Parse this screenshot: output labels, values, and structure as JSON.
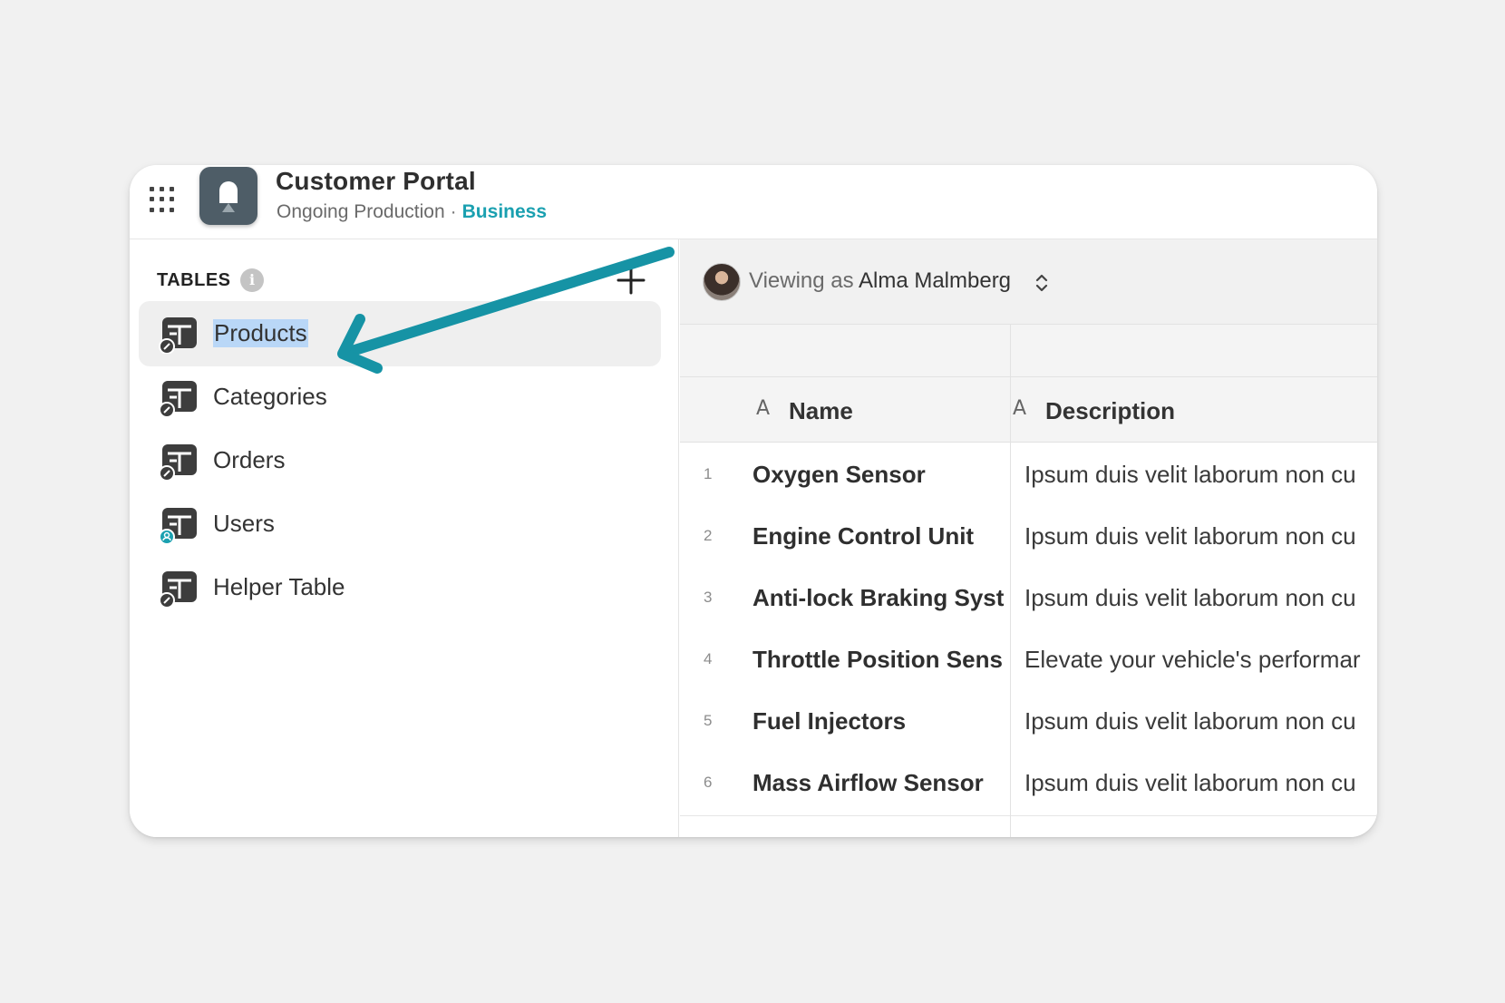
{
  "header": {
    "title": "Customer Portal",
    "subtitle": "Ongoing Production",
    "separator": "·",
    "plan": "Business",
    "menu_icon": "apps-grid-icon",
    "app_icon": "app-logo-icon"
  },
  "sidebar": {
    "section_label": "TABLES",
    "info_icon": "info-icon",
    "add_icon": "plus-icon",
    "items": [
      {
        "label": "Products",
        "icon": "table-icon",
        "selected": true
      },
      {
        "label": "Categories",
        "icon": "table-icon",
        "selected": false
      },
      {
        "label": "Orders",
        "icon": "table-icon",
        "selected": false
      },
      {
        "label": "Users",
        "icon": "users-table-icon",
        "selected": false
      },
      {
        "label": "Helper Table",
        "icon": "table-icon",
        "selected": false
      }
    ]
  },
  "viewbar": {
    "prefix": "Viewing as",
    "user": "Alma Malmberg",
    "switch_icon": "chevron-up-down-icon"
  },
  "table": {
    "columns": [
      {
        "type_icon": "A",
        "title": "Name"
      },
      {
        "type_icon": "A",
        "title": "Description"
      }
    ],
    "rows": [
      {
        "num": "1",
        "name": "Oxygen Sensor",
        "desc": "Ipsum duis velit laborum non cu"
      },
      {
        "num": "2",
        "name": "Engine Control Unit",
        "desc": "Ipsum duis velit laborum non cu"
      },
      {
        "num": "3",
        "name": "Anti-lock Braking Syst",
        "desc": "Ipsum duis velit laborum non cu"
      },
      {
        "num": "4",
        "name": "Throttle Position Sens",
        "desc": "Elevate your vehicle's performar"
      },
      {
        "num": "5",
        "name": "Fuel Injectors",
        "desc": "Ipsum duis velit laborum non cu"
      },
      {
        "num": "6",
        "name": "Mass Airflow Sensor",
        "desc": "Ipsum duis velit laborum non cu"
      }
    ]
  },
  "colors": {
    "accent": "#1aa0b0",
    "arrow": "#1693a5",
    "selection": "#b9d7f7"
  }
}
